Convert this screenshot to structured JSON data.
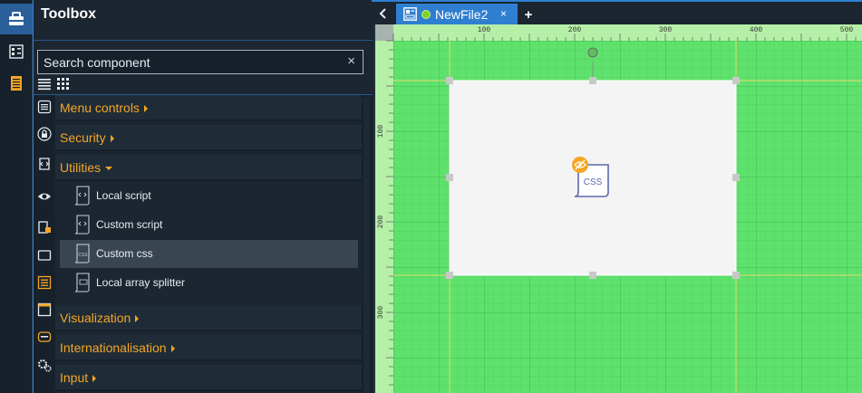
{
  "toolbox": {
    "title": "Toolbox",
    "search_placeholder": "Search component",
    "clear_symbol": "×",
    "categories": [
      {
        "label": "Menu controls",
        "icon": "list-icon",
        "expanded": false
      },
      {
        "label": "Security",
        "icon": "lock-icon",
        "expanded": false
      },
      {
        "label": "Utilities",
        "icon": "script-icon",
        "expanded": true
      },
      {
        "label": "Visualization",
        "icon": "monitor-icon",
        "expanded": false
      },
      {
        "label": "Internationalisation",
        "icon": "translate-icon",
        "expanded": false
      },
      {
        "label": "Input",
        "icon": "gear-icon",
        "expanded": false
      }
    ],
    "utilities_items": [
      {
        "label": "Local script",
        "icon": "script-icon",
        "selected": false
      },
      {
        "label": "Custom script",
        "icon": "script-icon",
        "selected": false
      },
      {
        "label": "Custom css",
        "icon": "css-file-icon",
        "selected": true
      },
      {
        "label": "Local array splitter",
        "icon": "array-splitter-icon",
        "selected": false
      }
    ]
  },
  "tabs": [
    {
      "label": "NewFile2",
      "close": "×",
      "modified": true
    }
  ],
  "tab_add": "+",
  "canvas": {
    "ruler_x_labels": [
      "100",
      "200",
      "300",
      "400",
      "500"
    ],
    "ruler_y_labels": [
      "100",
      "200",
      "300"
    ],
    "component_label": "CSS",
    "colors": {
      "grid_bg": "#5fe26d",
      "ruler": "#b6f0a8",
      "component_bg": "#f4f4f4",
      "accent": "#f5a623"
    }
  }
}
